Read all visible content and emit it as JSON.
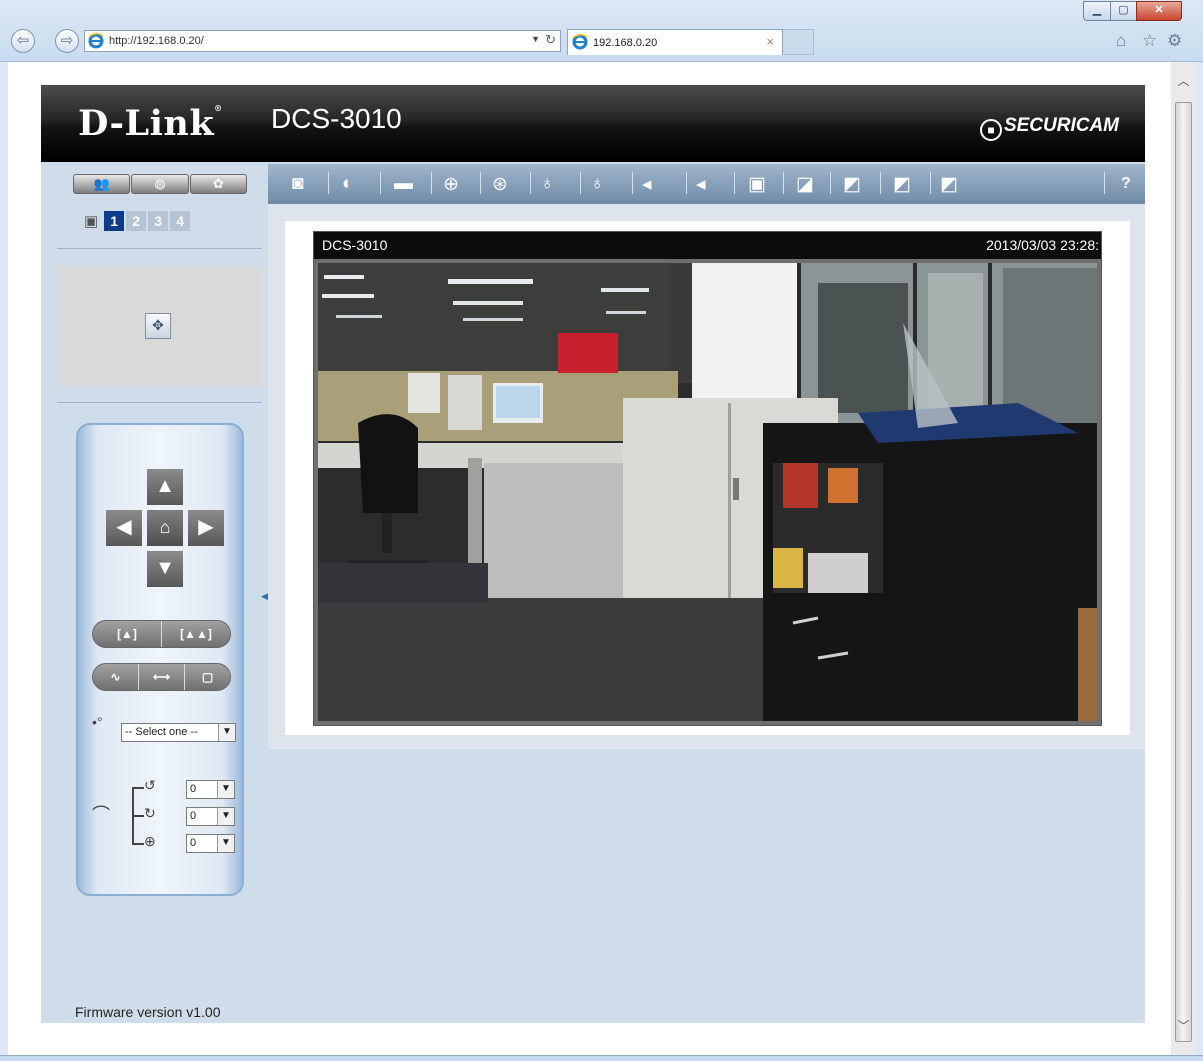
{
  "browser": {
    "address": "http://192.168.0.20/",
    "tab_title": "192.168.0.20",
    "back_icon": "back-arrow-icon",
    "forward_icon": "forward-arrow-icon"
  },
  "header": {
    "brand": "D-Link",
    "model": "DCS-3010",
    "securicam": "SECURICAM"
  },
  "left": {
    "channels": [
      "1",
      "2",
      "3",
      "4"
    ],
    "preset_select": "-- Select one --",
    "pan_speed": "0",
    "tilt_speed": "0",
    "zoom_speed": "0"
  },
  "toolbar": {
    "help": "?"
  },
  "video": {
    "overlay_name": "DCS-3010",
    "overlay_time": "2013/03/03 23:28:"
  },
  "footer": {
    "firmware": "Firmware version v1.00"
  },
  "colors": {
    "channel_active": "#0b3b8a",
    "page_bg": "#cedde9"
  }
}
